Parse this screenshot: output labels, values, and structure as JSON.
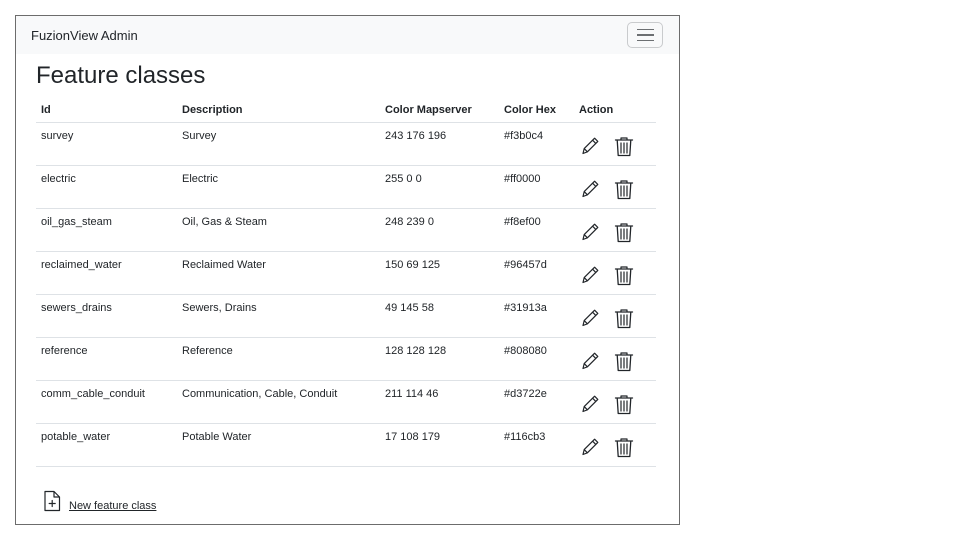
{
  "navbar": {
    "brand": "FuzionView Admin"
  },
  "page": {
    "title": "Feature classes"
  },
  "table": {
    "headers": {
      "id": "Id",
      "description": "Description",
      "color_mapserver": "Color Mapserver",
      "color_hex": "Color Hex",
      "action": "Action"
    },
    "rows": [
      {
        "id": "survey",
        "description": "Survey",
        "color_mapserver": "243 176 196",
        "color_hex": "#f3b0c4"
      },
      {
        "id": "electric",
        "description": "Electric",
        "color_mapserver": "255 0 0",
        "color_hex": "#ff0000"
      },
      {
        "id": "oil_gas_steam",
        "description": "Oil, Gas & Steam",
        "color_mapserver": "248 239 0",
        "color_hex": "#f8ef00"
      },
      {
        "id": "reclaimed_water",
        "description": "Reclaimed Water",
        "color_mapserver": "150 69 125",
        "color_hex": "#96457d"
      },
      {
        "id": "sewers_drains",
        "description": "Sewers, Drains",
        "color_mapserver": "49 145 58",
        "color_hex": "#31913a"
      },
      {
        "id": "reference",
        "description": "Reference",
        "color_mapserver": "128 128 128",
        "color_hex": "#808080"
      },
      {
        "id": "comm_cable_conduit",
        "description": "Communication, Cable, Conduit",
        "color_mapserver": "211 114 46",
        "color_hex": "#d3722e"
      },
      {
        "id": "potable_water",
        "description": "Potable Water",
        "color_mapserver": "17 108 179",
        "color_hex": "#116cb3"
      }
    ],
    "row_icons": [
      "pencil-icon",
      "trash-icon"
    ]
  },
  "footer": {
    "new_label": "New feature class",
    "new_icon": "file-plus-icon"
  }
}
